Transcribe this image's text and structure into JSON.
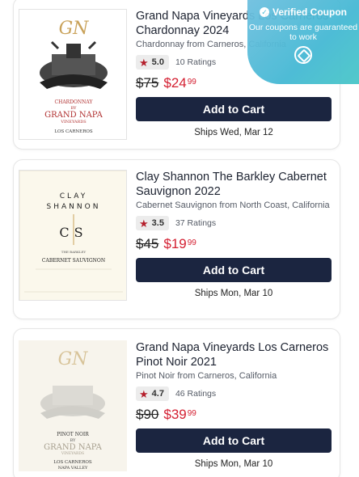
{
  "coupon": {
    "heading": "Verified Coupon",
    "text": "Our coupons are guaranteed to work"
  },
  "products": [
    {
      "title": "Grand Napa Vineyards Los Carneros Chardonnay 2024",
      "subtitle": "Chardonnay from Carneros, California",
      "rating": "5.0",
      "ratings_count": "10 Ratings",
      "old_price": "$75",
      "price_dollars": "$24",
      "price_cents": "99",
      "cart_label": "Add to Cart",
      "ships": "Ships Wed, Mar 12",
      "label": {
        "monogram": "GN",
        "varietal": "CHARDONNAY",
        "by": "BY",
        "brand": "GRAND NAPA",
        "sub": "VINEYARDS",
        "region": "LOS CARNEROS"
      }
    },
    {
      "title": "Clay Shannon The Barkley Cabernet Sauvignon 2022",
      "subtitle": "Cabernet Sauvignon from North Coast, California",
      "rating": "3.5",
      "ratings_count": "37 Ratings",
      "old_price": "$45",
      "price_dollars": "$19",
      "price_cents": "99",
      "cart_label": "Add to Cart",
      "ships": "Ships Mon, Mar 10",
      "label": {
        "line1": "CLAY",
        "line2": "SHANNON",
        "initials": "CS",
        "small": "THE BARKLEY",
        "varietal": "CABERNET SAUVIGNON"
      }
    },
    {
      "title": "Grand Napa Vineyards Los Carneros Pinot Noir 2021",
      "subtitle": "Pinot Noir from Carneros, California",
      "rating": "4.7",
      "ratings_count": "46 Ratings",
      "old_price": "$90",
      "price_dollars": "$39",
      "price_cents": "99",
      "cart_label": "Add to Cart",
      "ships": "Ships Mon, Mar 10",
      "label": {
        "monogram": "GN",
        "varietal": "PINOT NOIR",
        "by": "BY",
        "brand": "GRAND NAPA",
        "sub": "VINEYARDS",
        "region": "LOS CARNEROS",
        "region2": "NAPA VALLEY"
      }
    }
  ]
}
